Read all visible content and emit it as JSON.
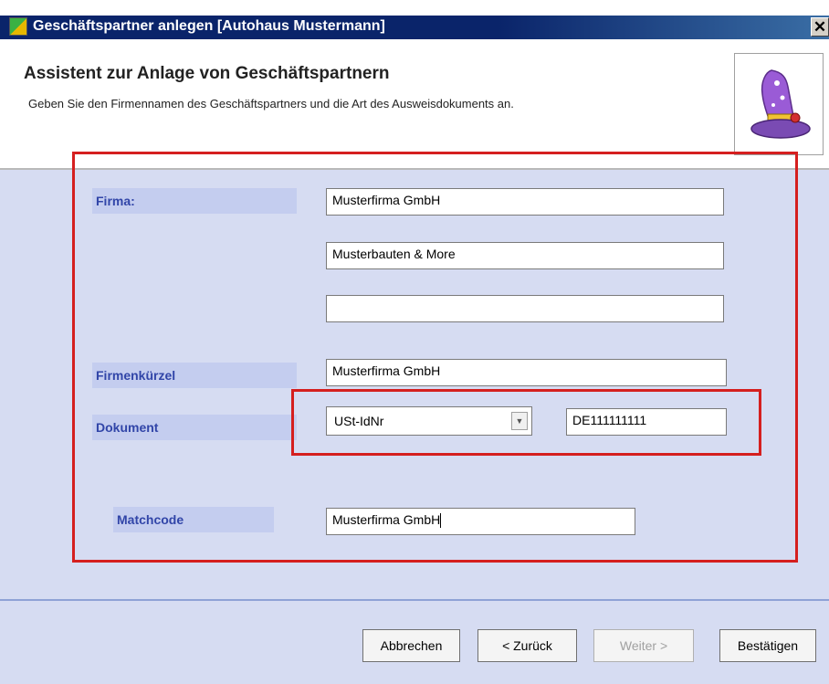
{
  "window": {
    "title": "Geschäftspartner anlegen [Autohaus Mustermann]",
    "close_glyph": "✕"
  },
  "header": {
    "title": "Assistent zur Anlage von Geschäftspartnern",
    "subtitle": "Geben Sie den Firmennamen des Geschäftspartners und die Art des Ausweisdokuments an.",
    "icon": "wizard-hat-icon"
  },
  "form": {
    "firma_label": "Firma:",
    "firma_line1": "Musterfirma GmbH",
    "firma_line2": "Musterbauten & More",
    "firma_line3": "",
    "kuerzel_label": "Firmenkürzel",
    "kuerzel_value": "Musterfirma GmbH",
    "dokument_label": "Dokument",
    "dokument_type": "USt-IdNr",
    "dokument_number": "DE111111111",
    "matchcode_label": "Matchcode",
    "matchcode_value": "Musterfirma GmbH"
  },
  "buttons": {
    "cancel": "Abbrechen",
    "back": "< Zurück",
    "next": "Weiter >",
    "confirm": "Bestätigen"
  },
  "colors": {
    "highlight": "#d51f1f",
    "label_text": "#3145a8",
    "form_background": "#d6dcf2"
  }
}
